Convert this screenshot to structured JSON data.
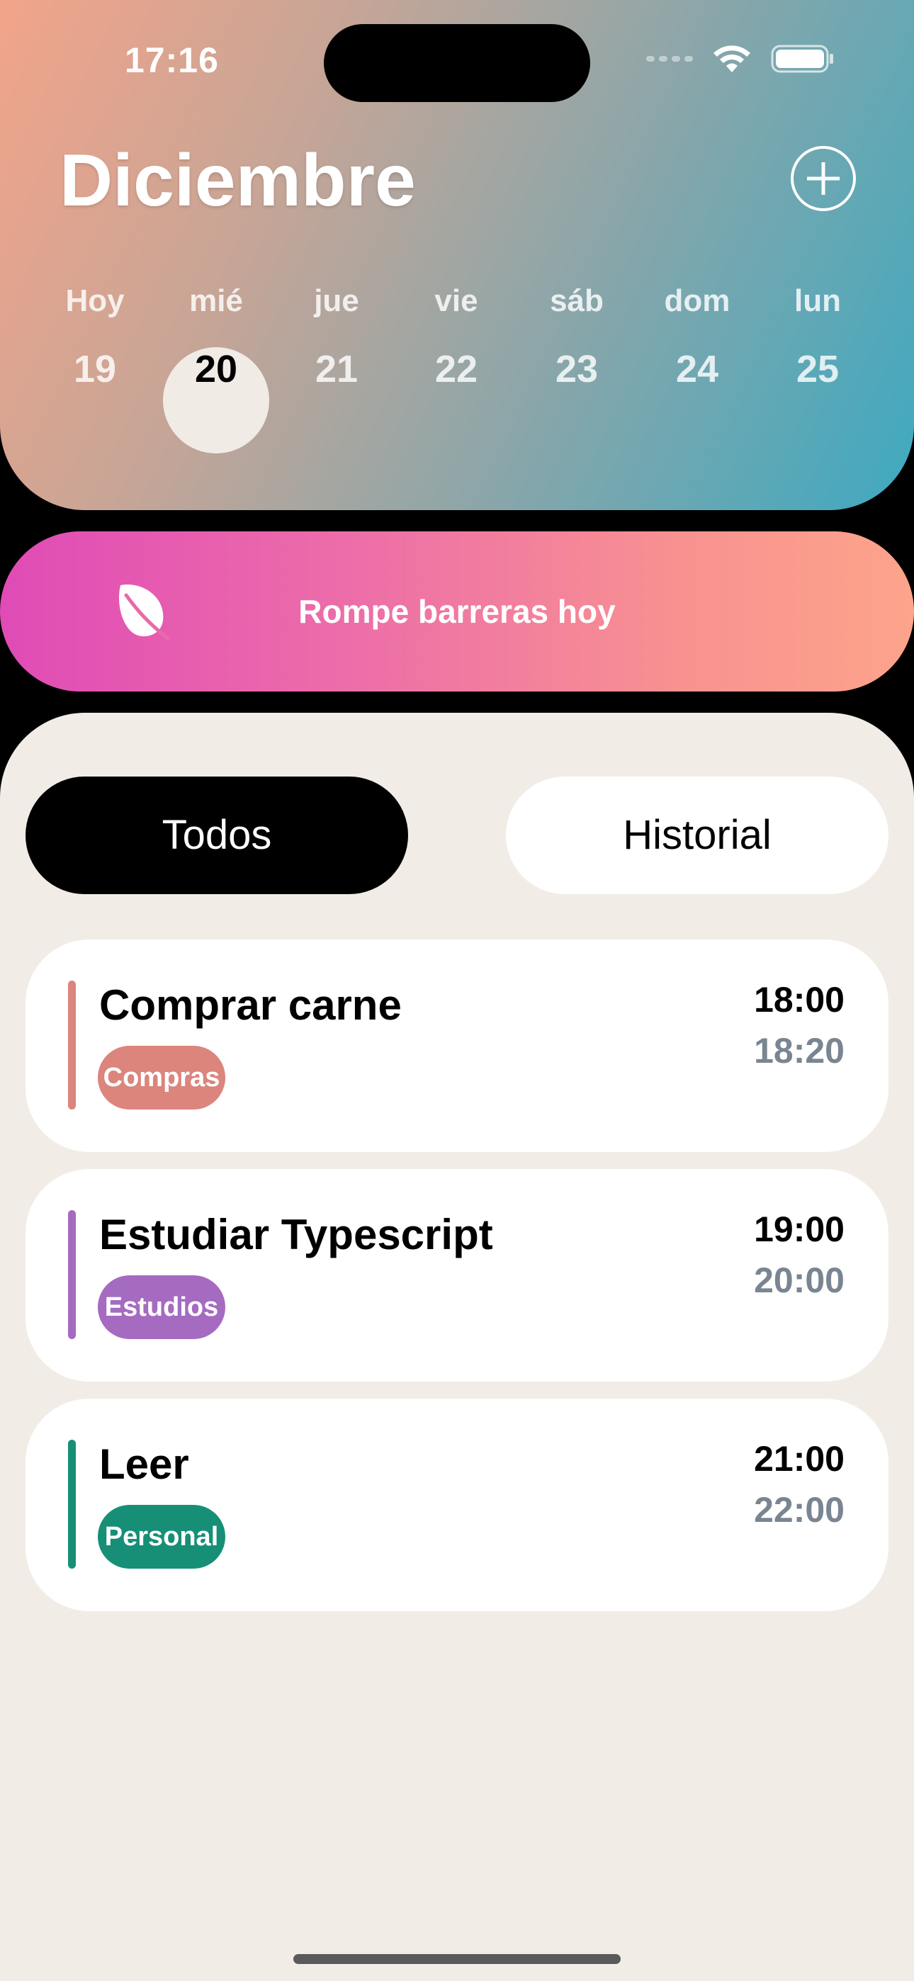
{
  "status_bar": {
    "time": "17:16"
  },
  "header": {
    "month": "Diciembre",
    "add_icon": "plus-circle-icon",
    "days": [
      {
        "name": "Hoy",
        "number": "19",
        "selected": false
      },
      {
        "name": "mié",
        "number": "20",
        "selected": true
      },
      {
        "name": "jue",
        "number": "21",
        "selected": false
      },
      {
        "name": "vie",
        "number": "22",
        "selected": false
      },
      {
        "name": "sáb",
        "number": "23",
        "selected": false
      },
      {
        "name": "dom",
        "number": "24",
        "selected": false
      },
      {
        "name": "lun",
        "number": "25",
        "selected": false
      }
    ]
  },
  "banner": {
    "icon": "leaf-icon",
    "text": "Rompe barreras hoy"
  },
  "tabs": {
    "all": "Todos",
    "history": "Historial",
    "active": "all"
  },
  "tasks": [
    {
      "title": "Comprar carne",
      "tag": "Compras",
      "color": "#db857c",
      "start": "18:00",
      "end": "18:20"
    },
    {
      "title": "Estudiar Typescript",
      "tag": "Estudios",
      "color": "#a56bc0",
      "start": "19:00",
      "end": "20:00"
    },
    {
      "title": "Leer",
      "tag": "Personal",
      "color": "#178f77",
      "start": "21:00",
      "end": "22:00"
    }
  ],
  "colors": {
    "tab_active": "#000000",
    "surface": "#f1ede6"
  }
}
